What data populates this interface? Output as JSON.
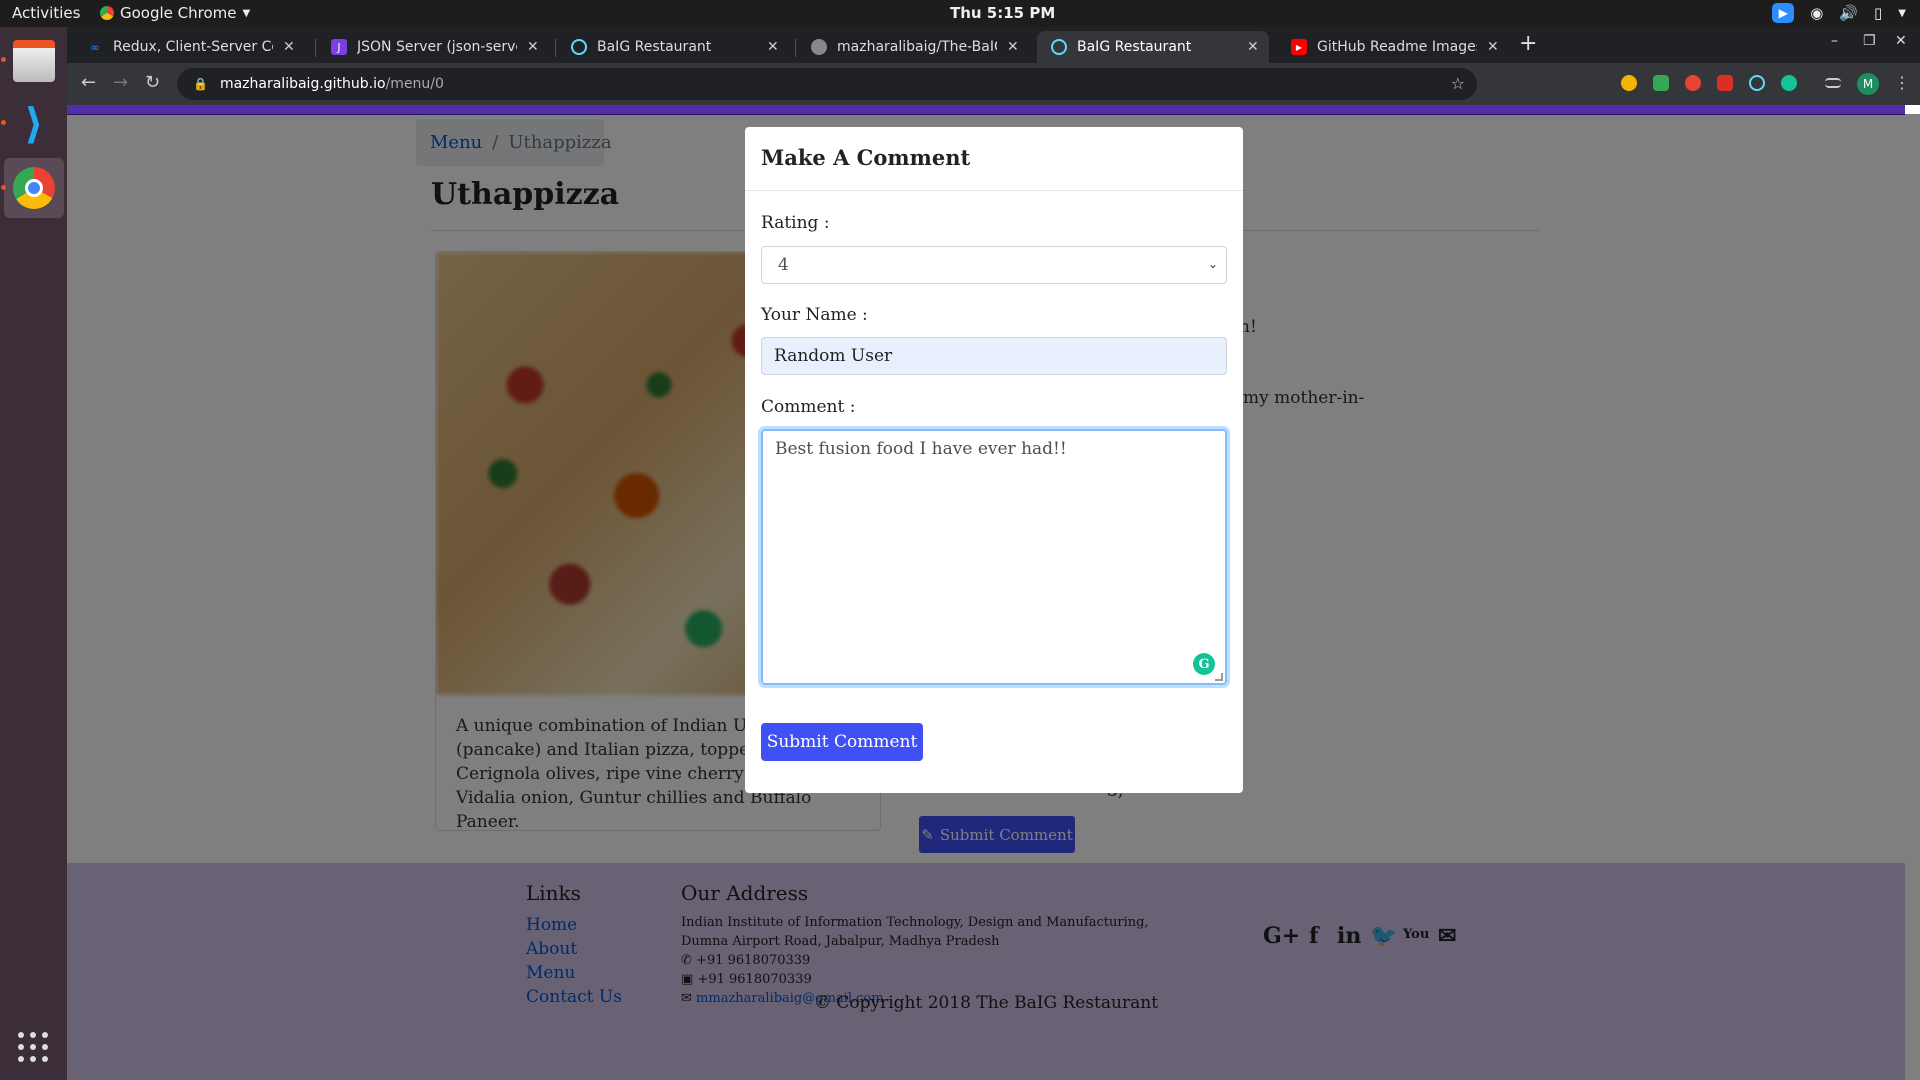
{
  "topbar": {
    "activities": "Activities",
    "app": "Google Chrome",
    "clock": "Thu  5:15 PM"
  },
  "tabs": [
    {
      "title": "Redux, Client-Server Com",
      "fav_color": "#1a73e8",
      "icon": "coursera-icon"
    },
    {
      "title": "JSON Server (json-server)",
      "fav_color": "#7b3fe4",
      "icon": "json-server-icon"
    },
    {
      "title": "BaIG Restaurant",
      "fav_color": "#61dafb",
      "icon": "react-icon"
    },
    {
      "title": "mazharalibaig/The-BaIG-",
      "fav_color": "#888888",
      "icon": "github-icon"
    },
    {
      "title": "BaIG Restaurant",
      "fav_color": "#61dafb",
      "icon": "react-icon",
      "active": true
    },
    {
      "title": "GitHub Readme Images T",
      "fav_color": "#ff0000",
      "icon": "youtube-icon"
    }
  ],
  "omnibox": {
    "host": "mazharalibaig.github.io",
    "path": "/menu/0"
  },
  "profile_initial": "M",
  "page": {
    "breadcrumb": {
      "link": "Menu",
      "current": "Uthappizza"
    },
    "title": "Uthappizza",
    "description": "A unique combination of Indian Uthappam (pancake) and Italian pizza, topped with Cerignola olives, ripe vine cherry tomatoes, Vidalia onion, Guntur chillies and Buffalo Paneer.",
    "visible_fragments": {
      "f1": "n!",
      "f2": "my mother-in-",
      "f3": "3,"
    },
    "submit_comment_bg": "Submit Comment"
  },
  "footer": {
    "links_heading": "Links",
    "links": [
      "Home",
      "About",
      "Menu",
      "Contact Us"
    ],
    "address_heading": "Our Address",
    "address_line1": "Indian Institute of Information Technology, Design and Manufacturing,",
    "address_line2": "Dumna Airport Road, Jabalpur, Madhya Pradesh",
    "phone": "+91 9618070339",
    "fax": "+91 9618070339",
    "email": "mmazharalibaig@gmail.com",
    "social": [
      "G+",
      "f",
      "in",
      "🐦",
      "You",
      "✉"
    ],
    "copyright": "© Copyright 2018 The BaIG Restaurant"
  },
  "modal": {
    "title": "Make A Comment",
    "rating_label": "Rating :",
    "rating_value": "4",
    "name_label": "Your Name :",
    "name_value": "Random User",
    "comment_label": "Comment :",
    "comment_value": "Best fusion food I have ever had!!",
    "submit_label": "Submit Comment"
  },
  "colors": {
    "accent": "#3f51f5",
    "navbar": "#512da8",
    "footer": "#d1c4e9"
  }
}
